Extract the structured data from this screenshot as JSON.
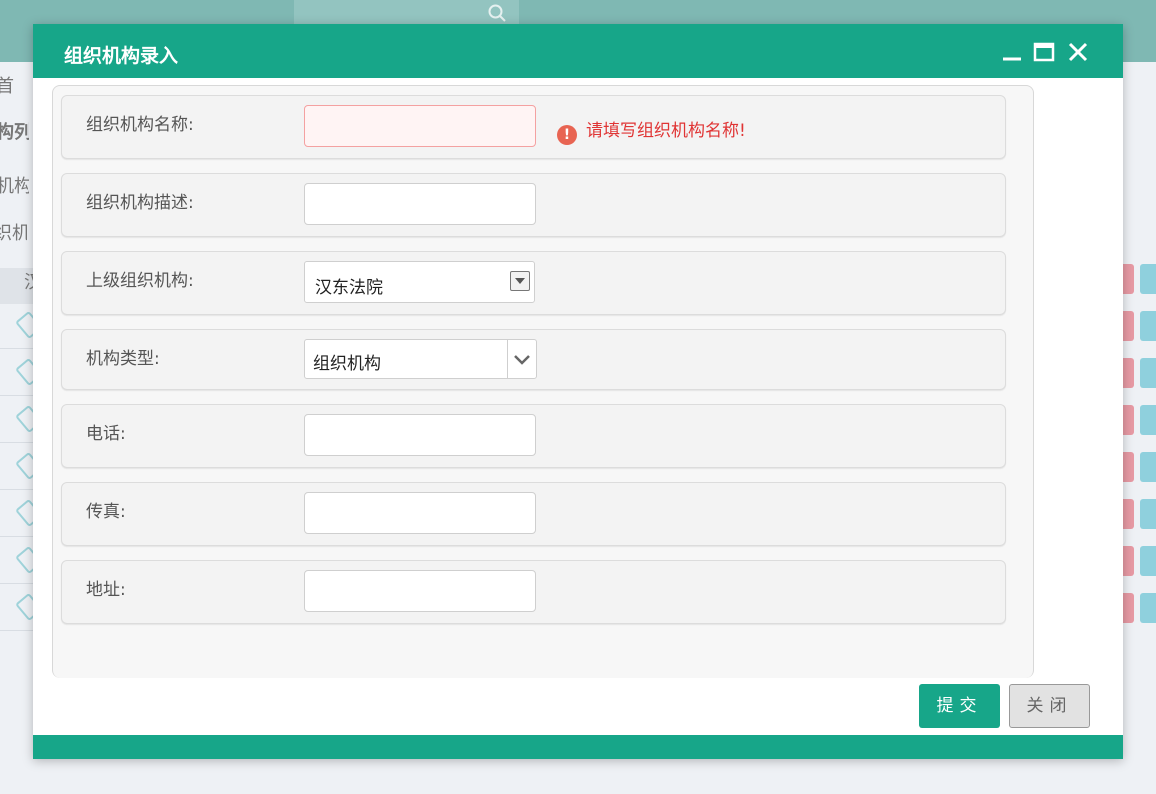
{
  "background": {
    "nav_home": "首",
    "nav_list": "构列",
    "nav_item1": "机构",
    "nav_item2": "织机构",
    "tree_root": "汉"
  },
  "dialog": {
    "title": "组织机构录入",
    "controls": [
      "minimize-icon",
      "maximize-icon",
      "close-icon"
    ]
  },
  "form": {
    "name": {
      "label": "组织机构名称:",
      "value": "",
      "error": "请填写组织机构名称!"
    },
    "description": {
      "label": "组织机构描述:",
      "value": ""
    },
    "parent": {
      "label": "上级组织机构:",
      "value": "汉东法院"
    },
    "type": {
      "label": "机构类型:",
      "value": "组织机构"
    },
    "phone": {
      "label": "电话:",
      "value": ""
    },
    "fax": {
      "label": "传真:",
      "value": ""
    },
    "address": {
      "label": "地址:",
      "value": ""
    }
  },
  "buttons": {
    "submit": "提交",
    "close": "关闭"
  },
  "colors": {
    "primary": "#17a689",
    "error": "#e03434",
    "error_icon": "#e86452"
  }
}
